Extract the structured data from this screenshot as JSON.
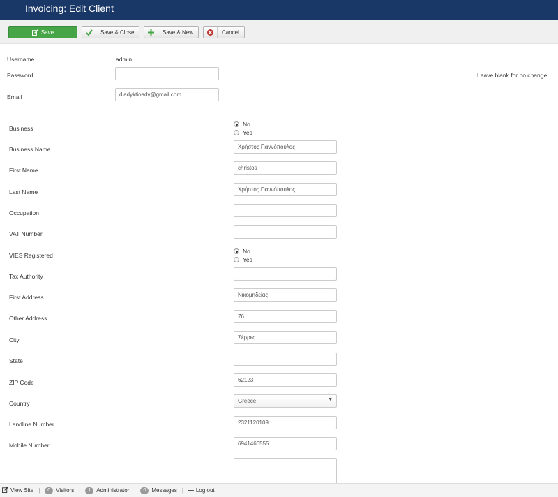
{
  "header": {
    "title": "Invoicing: Edit Client"
  },
  "toolbar": {
    "save": "Save",
    "save_close": "Save & Close",
    "save_new": "Save & New",
    "cancel": "Cancel"
  },
  "account": {
    "username_label": "Username",
    "username_value": "admin",
    "password_label": "Password",
    "password_value": "",
    "password_hint": "Leave blank for no change",
    "email_label": "Email",
    "email_value": "diadyktioadv@gmail.com"
  },
  "client": {
    "business_label": "Business",
    "business_options": [
      "No",
      "Yes"
    ],
    "business_selected": "No",
    "business_name_label": "Business Name",
    "business_name_value": "Χρήστος Γιαννόπουλος",
    "first_name_label": "First Name",
    "first_name_value": "christos",
    "last_name_label": "Last Name",
    "last_name_value": "Χρήστος Γιαννόπουλος",
    "occupation_label": "Occupation",
    "occupation_value": "",
    "vat_label": "VAT Number",
    "vat_value": "",
    "vies_label": "VIES Registered",
    "vies_options": [
      "No",
      "Yes"
    ],
    "vies_selected": "No",
    "tax_authority_label": "Tax Authority",
    "tax_authority_value": "",
    "first_address_label": "First Address",
    "first_address_value": "Νικομηδείας",
    "other_address_label": "Other Address",
    "other_address_value": "76",
    "city_label": "City",
    "city_value": "Σέρρες",
    "state_label": "State",
    "state_value": "",
    "zip_label": "ZIP Code",
    "zip_value": "62123",
    "country_label": "Country",
    "country_value": "Greece",
    "landline_label": "Landline Number",
    "landline_value": "2321120109",
    "mobile_label": "Mobile Number",
    "mobile_value": "6941466555",
    "notes_value": ""
  },
  "statusbar": {
    "view_site": "View Site",
    "visitors_count": "0",
    "visitors_label": "Visitors",
    "admin_count": "1",
    "admin_label": "Administrator",
    "messages_count": "0",
    "messages_label": "Messages",
    "logout": "Log out"
  },
  "colors": {
    "header_bg": "#1a3867",
    "save_green": "#46a546",
    "cancel_red": "#bd362f"
  }
}
